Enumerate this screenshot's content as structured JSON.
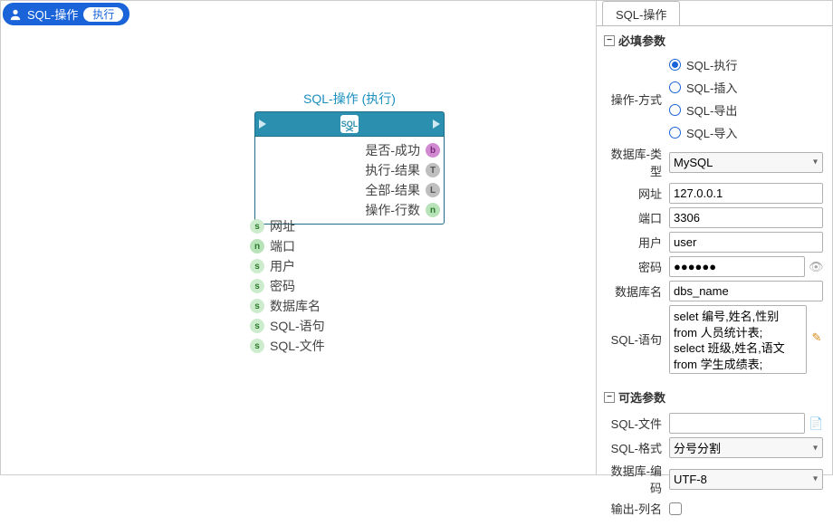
{
  "header": {
    "title": "SQL-操作",
    "pill": "执行"
  },
  "node": {
    "title": "SQL-操作 (执行)",
    "iconLabel": "SQL",
    "outputs": [
      {
        "label": "是否-成功",
        "pin": "b"
      },
      {
        "label": "执行-结果",
        "pin": "T"
      },
      {
        "label": "全部-结果",
        "pin": "L"
      },
      {
        "label": "操作-行数",
        "pin": "n"
      }
    ],
    "inputs": [
      {
        "label": "网址",
        "pin": "s"
      },
      {
        "label": "端口",
        "pin": "n"
      },
      {
        "label": "用户",
        "pin": "s"
      },
      {
        "label": "密码",
        "pin": "s"
      },
      {
        "label": "数据库名",
        "pin": "s"
      },
      {
        "label": "SQL-语句",
        "pin": "s"
      },
      {
        "label": "SQL-文件",
        "pin": "s"
      }
    ]
  },
  "panel": {
    "tab": "SQL-操作",
    "requiredTitle": "必填参数",
    "optionalTitle": "可选参数",
    "labels": {
      "mode": "操作-方式",
      "dbType": "数据库-类型",
      "host": "网址",
      "port": "端口",
      "user": "用户",
      "password": "密码",
      "dbName": "数据库名",
      "sqlStmt": "SQL-语句",
      "sqlFile": "SQL-文件",
      "sqlFormat": "SQL-格式",
      "dbEncoding": "数据库-编码",
      "outCols": "输出-列名"
    },
    "modeOptions": [
      "SQL-执行",
      "SQL-插入",
      "SQL-导出",
      "SQL-导入"
    ],
    "modeSelected": "SQL-执行",
    "dbType": "MySQL",
    "host": "127.0.0.1",
    "port": "3306",
    "user": "user",
    "passwordMasked": "●●●●●●",
    "dbName": "dbs_name",
    "sqlStmt": "selet 编号,姓名,性别\nfrom 人员统计表;\nselect 班级,姓名,语文\nfrom 学生成绩表;",
    "sqlFile": "",
    "sqlFormat": "分号分割",
    "dbEncoding": "UTF-8",
    "outColsChecked": false
  }
}
